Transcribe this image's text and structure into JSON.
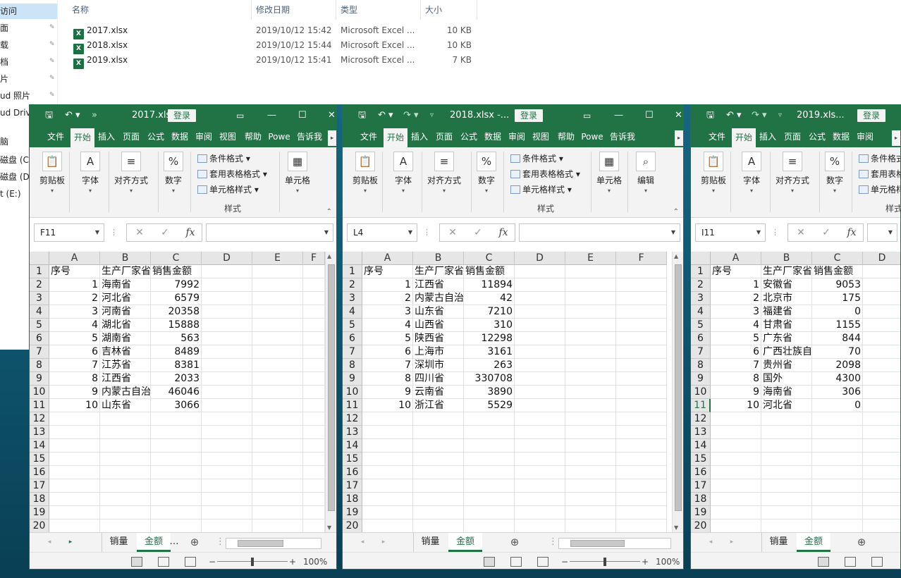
{
  "explorer": {
    "nav": [
      {
        "label": "访问",
        "selected": true
      },
      {
        "label": "面",
        "pinned": true
      },
      {
        "label": "载",
        "pinned": true
      },
      {
        "label": "档",
        "pinned": true
      },
      {
        "label": "片",
        "pinned": true
      },
      {
        "label": "ud 照片",
        "pinned": true
      },
      {
        "label": "ud Drive"
      },
      {
        "label": ""
      },
      {
        "label": "脑"
      },
      {
        "label": "磁盘 (C:)"
      },
      {
        "label": "磁盘 (D:)"
      },
      {
        "label": "t (E:)"
      }
    ],
    "columns": {
      "name": "名称",
      "modified": "修改日期",
      "type": "类型",
      "size": "大小"
    },
    "files": [
      {
        "name": "2017.xlsx",
        "modified": "2019/10/12 15:42",
        "type": "Microsoft Excel ...",
        "size": "10 KB"
      },
      {
        "name": "2018.xlsx",
        "modified": "2019/10/12 15:44",
        "type": "Microsoft Excel ...",
        "size": "10 KB"
      },
      {
        "name": "2019.xlsx",
        "modified": "2019/10/12 15:41",
        "type": "Microsoft Excel ...",
        "size": "7 KB"
      }
    ]
  },
  "common": {
    "login": "登录",
    "tabs": [
      "文件",
      "开始",
      "插入",
      "页面",
      "公式",
      "数据",
      "审阅",
      "视图",
      "帮助",
      "Powe",
      "告诉我"
    ],
    "ribbon": {
      "clipboard": "剪贴板",
      "font": "字体",
      "align": "对齐方式",
      "number": "数字",
      "cond_format": "条件格式",
      "table_format": "套用表格格式",
      "cell_style": "单元格样式",
      "styles_group": "样式",
      "cells": "单元格",
      "editing": "编辑"
    },
    "fx": "fx",
    "cols": [
      "A",
      "B",
      "C",
      "D",
      "E",
      "F"
    ],
    "sheet_tabs": [
      "销量",
      "金额"
    ],
    "zoom": "100%",
    "headers": [
      "序号",
      "生产厂家省",
      "销售金额"
    ]
  },
  "windows": [
    {
      "title": "2017.xlsx...",
      "namebox": "F11",
      "selected_row": null,
      "rows": [
        {
          "id": 1,
          "prov": "海南省",
          "amount": "7992"
        },
        {
          "id": 2,
          "prov": "河北省",
          "amount": "6579"
        },
        {
          "id": 3,
          "prov": "河南省",
          "amount": "20358"
        },
        {
          "id": 4,
          "prov": "湖北省",
          "amount": "15888"
        },
        {
          "id": 5,
          "prov": "湖南省",
          "amount": "563"
        },
        {
          "id": 6,
          "prov": "吉林省",
          "amount": "8489"
        },
        {
          "id": 7,
          "prov": "江苏省",
          "amount": "8381"
        },
        {
          "id": 8,
          "prov": "江西省",
          "amount": "2033"
        },
        {
          "id": 9,
          "prov": "内蒙古自治",
          "amount": "46046"
        },
        {
          "id": 10,
          "prov": "山东省",
          "amount": "3066"
        }
      ]
    },
    {
      "title": "2018.xlsx -...",
      "namebox": "L4",
      "selected_row": null,
      "rows": [
        {
          "id": 1,
          "prov": "江西省",
          "amount": "11894"
        },
        {
          "id": 2,
          "prov": "内蒙古自治",
          "amount": "42"
        },
        {
          "id": 3,
          "prov": "山东省",
          "amount": "7210"
        },
        {
          "id": 4,
          "prov": "山西省",
          "amount": "310"
        },
        {
          "id": 5,
          "prov": "陕西省",
          "amount": "12298"
        },
        {
          "id": 6,
          "prov": "上海市",
          "amount": "3161"
        },
        {
          "id": 7,
          "prov": "深圳市",
          "amount": "263"
        },
        {
          "id": 8,
          "prov": "四川省",
          "amount": "330708"
        },
        {
          "id": 9,
          "prov": "云南省",
          "amount": "3890"
        },
        {
          "id": 10,
          "prov": "浙江省",
          "amount": "5529"
        }
      ]
    },
    {
      "title": "2019.xls...",
      "namebox": "I11",
      "selected_row": 11,
      "rows": [
        {
          "id": 1,
          "prov": "安徽省",
          "amount": "9053"
        },
        {
          "id": 2,
          "prov": "北京市",
          "amount": "175"
        },
        {
          "id": 3,
          "prov": "福建省",
          "amount": "0"
        },
        {
          "id": 4,
          "prov": "甘肃省",
          "amount": "1155"
        },
        {
          "id": 5,
          "prov": "广东省",
          "amount": "844"
        },
        {
          "id": 6,
          "prov": "广西壮族自",
          "amount": "70"
        },
        {
          "id": 7,
          "prov": "贵州省",
          "amount": "2098"
        },
        {
          "id": 8,
          "prov": "国外",
          "amount": "4300"
        },
        {
          "id": 9,
          "prov": "海南省",
          "amount": "306"
        },
        {
          "id": 10,
          "prov": "河北省",
          "amount": "0"
        }
      ]
    }
  ]
}
